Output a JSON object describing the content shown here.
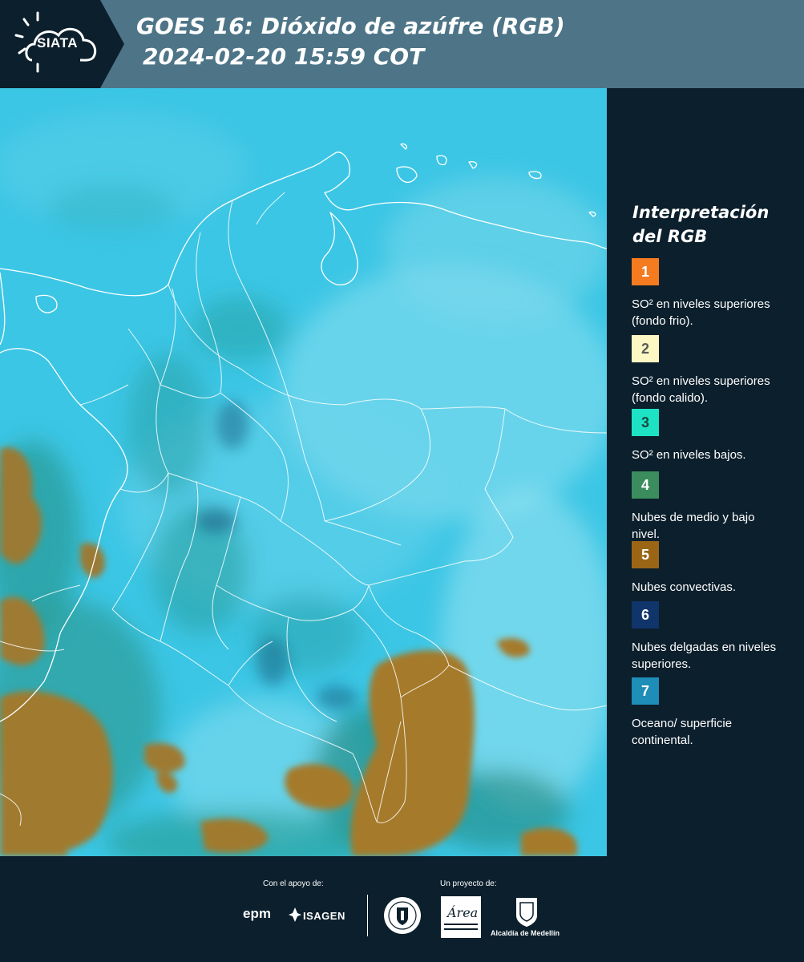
{
  "header": {
    "logo_text": "SIATA",
    "title_line1": "GOES 16: Dióxido de azúfre (RGB)",
    "title_line2": "2024-02-20 15:59 COT"
  },
  "legend": {
    "title": "Interpretación del RGB",
    "items": [
      {
        "number": "1",
        "label": "SO² en niveles superiores (fondo frio).",
        "color": "#f47b20",
        "text_color": "#ffffff"
      },
      {
        "number": "2",
        "label": "SO² en niveles superiores (fondo calido).",
        "color": "#fdf7c3",
        "text_color": "#5a5a5a"
      },
      {
        "number": "3",
        "label": "SO² en niveles bajos.",
        "color": "#1de3c4",
        "text_color": "#1a4a44"
      },
      {
        "number": "4",
        "label": "Nubes de medio y bajo nivel.",
        "color": "#3b8d5e",
        "text_color": "#ffffff"
      },
      {
        "number": "5",
        "label": "Nubes convectivas.",
        "color": "#9a6616",
        "text_color": "#ffffff"
      },
      {
        "number": "6",
        "label": "Nubes delgadas en niveles superiores.",
        "color": "#10356b",
        "text_color": "#ffffff"
      },
      {
        "number": "7",
        "label": "Oceano/ superficie continental.",
        "color": "#1e8db8",
        "text_color": "#ffffff"
      }
    ]
  },
  "footer": {
    "support_label": "Con el apoyo de:",
    "project_label": "Un proyecto de:",
    "sponsor1": "epm",
    "sponsor2": "ISAGEN",
    "partner1": "Área",
    "partner2": "Alcaldía de Medellín"
  },
  "colors": {
    "header_bg": "#4d7587",
    "logo_bg": "#0c1f2c",
    "panel_bg": "#0c1f2c",
    "map_cyan": "#3fc9e6",
    "cloud_brown": "#a57a2c"
  }
}
